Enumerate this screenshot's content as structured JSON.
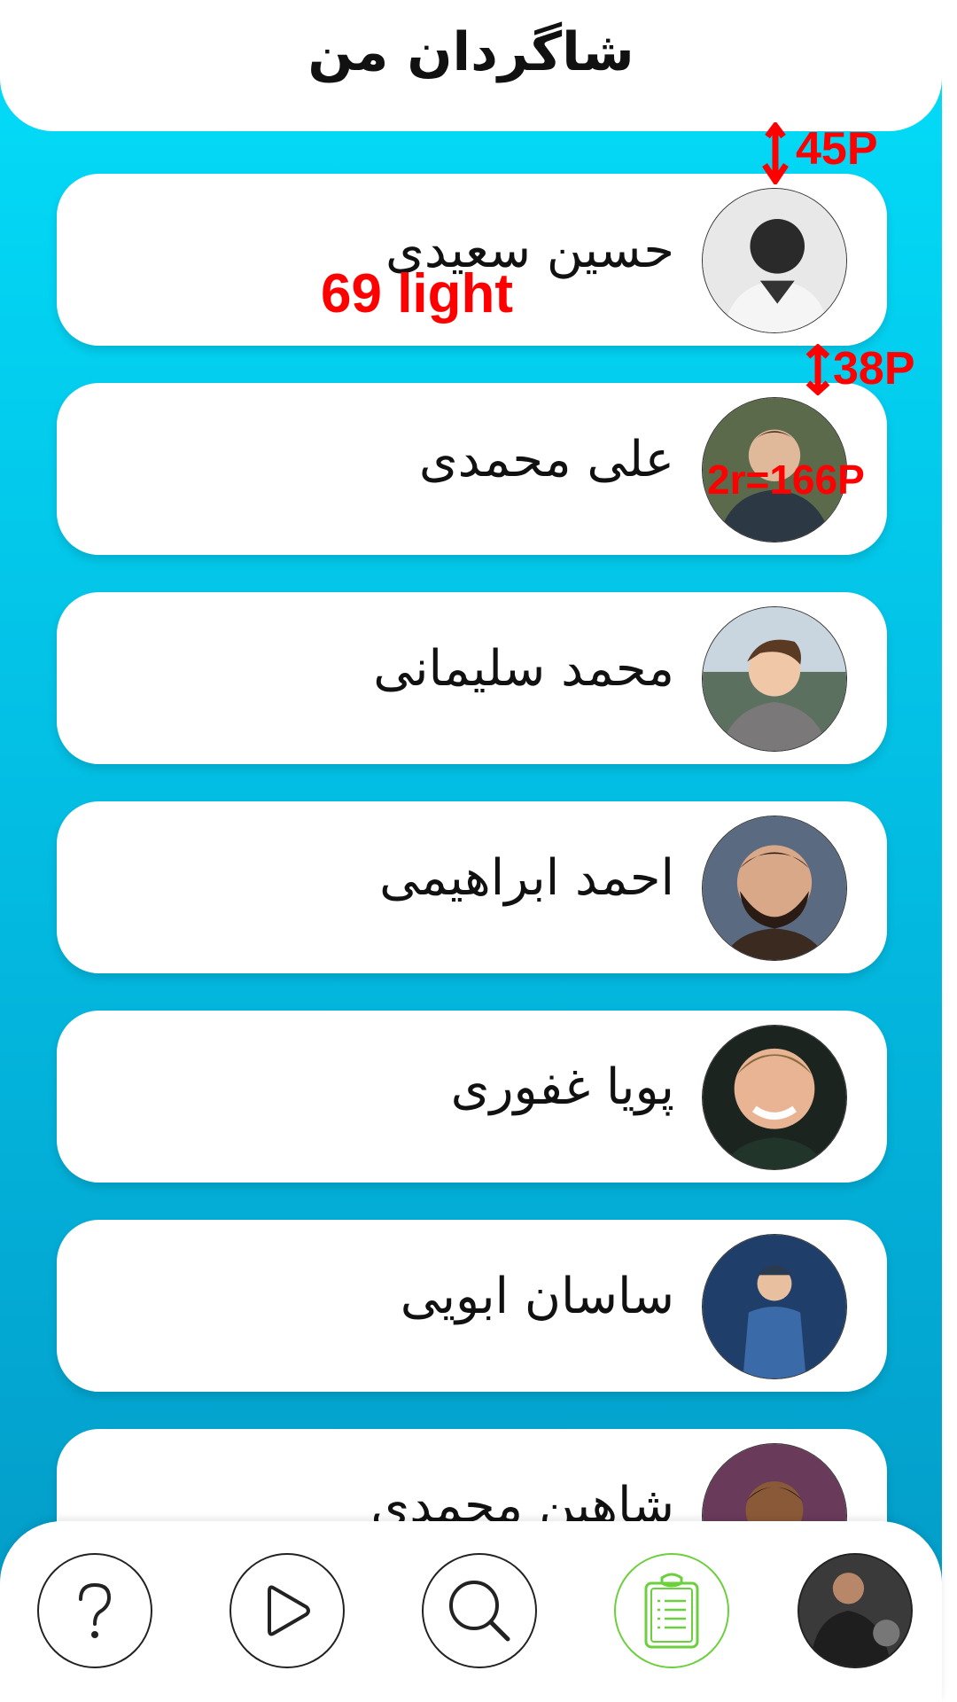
{
  "header": {
    "title": "شاگردان من"
  },
  "students": [
    {
      "name": "حسین سعیدی"
    },
    {
      "name": "علی محمدی"
    },
    {
      "name": "محمد سلیمانی"
    },
    {
      "name": "احمد ابراهیمی"
    },
    {
      "name": "پویا غفوری"
    },
    {
      "name": "ساسان ابویی"
    },
    {
      "name": "شاهین محمدی"
    }
  ],
  "annotations": {
    "gap_top": "45P",
    "font_note": "69 light",
    "gap_between": "38P",
    "avatar_size": "2r=166P"
  },
  "nav": {
    "items": [
      {
        "icon": "help-icon"
      },
      {
        "icon": "play-icon"
      },
      {
        "icon": "search-icon"
      },
      {
        "icon": "clipboard-icon",
        "active": true
      },
      {
        "icon": "profile-avatar"
      }
    ],
    "active_color": "#6ccf3d"
  },
  "colors": {
    "gradient_top": "#03ddf9",
    "gradient_bottom": "#0399c6",
    "annotation": "#ff0000"
  }
}
